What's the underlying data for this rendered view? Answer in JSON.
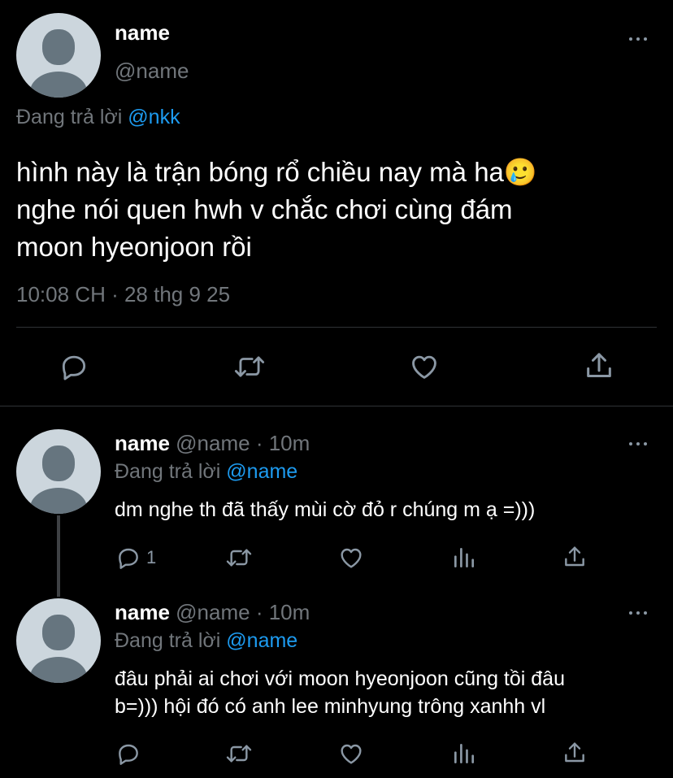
{
  "main_tweet": {
    "display_name": "name",
    "handle": "@name",
    "reply_prefix": "Đang trả lời",
    "reply_to": "@nkk",
    "text_lines": [
      "hình này là trận bóng rổ chiều nay mà ha🥲",
      "nghe nói quen hwh v chắc chơi cùng đám",
      "moon hyeonjoon rồi"
    ],
    "timestamp": "10:08 CH · 28 thg 9 25"
  },
  "replies": [
    {
      "display_name": "name",
      "handle": "@name",
      "time": "· 10m",
      "reply_prefix": "Đang trả lời",
      "reply_to": "@name",
      "text_lines": [
        "dm nghe th đã thấy mùi cờ đỏ r chúng m ạ =)))"
      ],
      "reply_count": "1"
    },
    {
      "display_name": "name",
      "handle": "@name",
      "time": "· 10m",
      "reply_prefix": "Đang trả lời",
      "reply_to": "@name",
      "text_lines": [
        "đâu phải ai chơi với moon hyeonjoon cũng tồi đâu",
        "b=))) hội đó có anh lee minhyung trông xanhh vl"
      ],
      "reply_count": ""
    }
  ],
  "icons": {
    "reply": "reply-icon",
    "retweet": "retweet-icon",
    "like": "heart-icon",
    "views": "views-icon",
    "share": "share-icon",
    "more": "more-icon"
  },
  "colors": {
    "background": "#000000",
    "text": "#e7e9ea",
    "muted": "#71767b",
    "link": "#1d9bf0",
    "divider": "#2f3336"
  }
}
